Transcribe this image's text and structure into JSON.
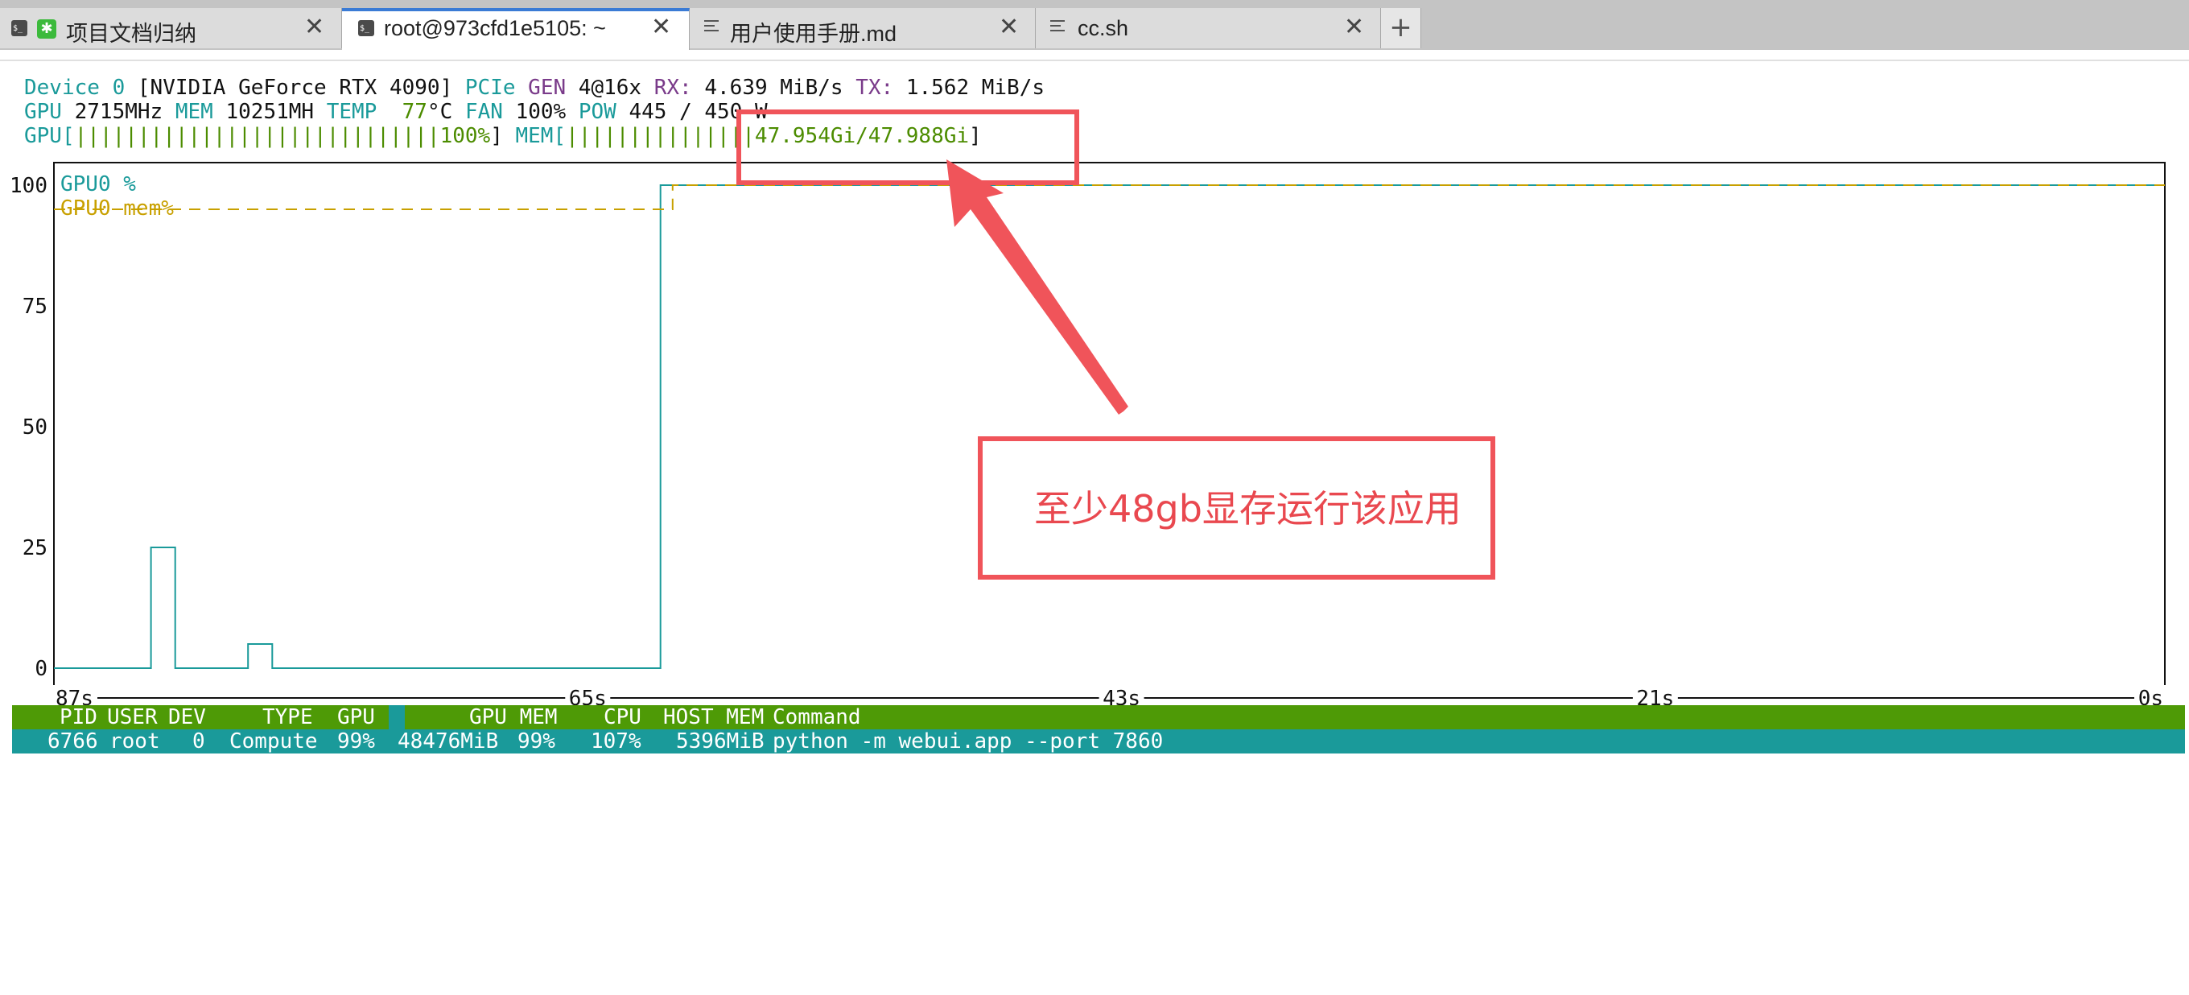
{
  "tabs": [
    {
      "label": "项目文档归纳",
      "icon": "terminal-icon",
      "extra_icon": "green-app-icon",
      "active": false
    },
    {
      "label": "root@973cfd1e5105: ~",
      "icon": "terminal-icon",
      "active": true
    },
    {
      "label": "用户使用手册.md",
      "icon": "document-icon",
      "active": false
    },
    {
      "label": "cc.sh",
      "icon": "document-icon",
      "active": false
    }
  ],
  "tab_close_glyph": "✕",
  "tab_add_glyph": "+",
  "device": {
    "device_label": "Device",
    "index": "0",
    "name": "[NVIDIA GeForce RTX 4090]",
    "pcie_label": "PCIe",
    "gen_label": "GEN",
    "gen_value": "4@16x",
    "rx_label": "RX:",
    "rx_value": "4.639 MiB/s",
    "tx_label": "TX:",
    "tx_value": "1.562 MiB/s",
    "gpu_label": "GPU",
    "gpu_clock": "2715MHz",
    "mem_label": "MEM",
    "mem_clock": "10251MH",
    "temp_label": "TEMP",
    "temp_value": "77",
    "temp_unit": "°C",
    "fan_label": "FAN",
    "fan_value": "100%",
    "pow_label": "POW",
    "pow_value": "445 / 450 W",
    "gpu_bar_label": "GPU[",
    "gpu_bar": "|||||||||||||||||||||||||||||100%",
    "mem_bar_label": "MEM[",
    "mem_bar": "|||||||||||||||47.954Gi/47.988Gi",
    "bar_close": "]"
  },
  "chart_data": {
    "type": "line",
    "y_ticks": [
      "100",
      "75",
      "50",
      "25",
      "0"
    ],
    "ylim": [
      0,
      100
    ],
    "x_ticks": [
      "87s",
      "65s",
      "43s",
      "21s",
      "0s"
    ],
    "xlim_seconds_ago": [
      87,
      0
    ],
    "series": [
      {
        "name": "GPU0 %",
        "color": "#1a9a9a",
        "points": [
          [
            87,
            0
          ],
          [
            83,
            0
          ],
          [
            83,
            25
          ],
          [
            82,
            25
          ],
          [
            82,
            0
          ],
          [
            79,
            0
          ],
          [
            79,
            5
          ],
          [
            78,
            5
          ],
          [
            78,
            0
          ],
          [
            62,
            0
          ],
          [
            62,
            100
          ],
          [
            0,
            100
          ]
        ]
      },
      {
        "name": "GPU0 mem%",
        "color": "#c8a000",
        "points": [
          [
            87,
            95
          ],
          [
            61.5,
            95
          ],
          [
            61.5,
            100
          ],
          [
            0,
            100
          ]
        ]
      }
    ]
  },
  "process_table": {
    "columns": [
      "PID",
      "USER",
      "DEV",
      "TYPE",
      "GPU",
      "GPU MEM",
      "CPU",
      "HOST MEM",
      "Command"
    ],
    "rows": [
      {
        "pid": "6766",
        "user": "root",
        "dev": "0",
        "type": "Compute",
        "gpu": "99%",
        "gpu_mem": "48476MiB",
        "gpu_mem_pct": "99%",
        "cpu": "107%",
        "host_mem": "5396MiB",
        "command": "python -m webui.app --port 7860"
      }
    ]
  },
  "annotation": {
    "text": "至少48gb显存运行该应用",
    "color": "#f0545a"
  }
}
